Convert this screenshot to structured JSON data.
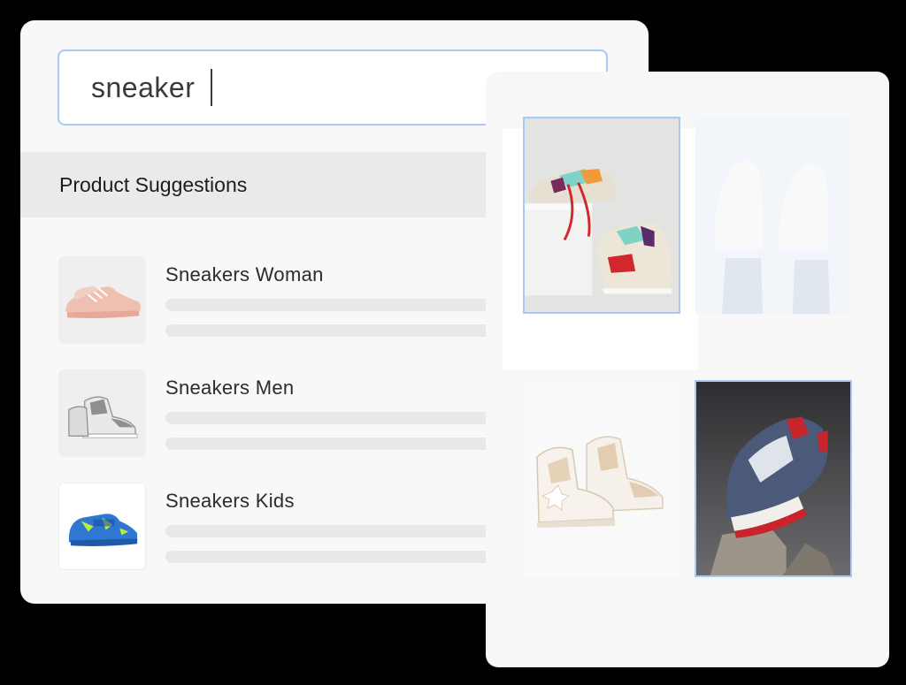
{
  "search": {
    "value": "sneaker"
  },
  "suggestions": {
    "title": "Product Suggestions",
    "items": [
      {
        "name": "Sneakers Woman",
        "image": "pink-sneaker"
      },
      {
        "name": "Sneakers Men",
        "image": "grey-high-top-sneaker"
      },
      {
        "name": "Sneakers Kids",
        "image": "blue-kids-sneaker"
      }
    ]
  },
  "gallery": {
    "images": [
      {
        "image": "colorful-sneakers-on-pedestal",
        "selected": true
      },
      {
        "image": "white-sneakers-on-legs",
        "selected": false
      },
      {
        "image": "beige-star-high-top",
        "selected": false
      },
      {
        "image": "navy-chunky-sneaker-on-rock",
        "selected": true
      }
    ]
  },
  "colors": {
    "focus_border": "#a9c9f3",
    "panel_bg": "#f8f8f8",
    "header_bg": "#eaeaea",
    "page_bg": "#000000"
  }
}
